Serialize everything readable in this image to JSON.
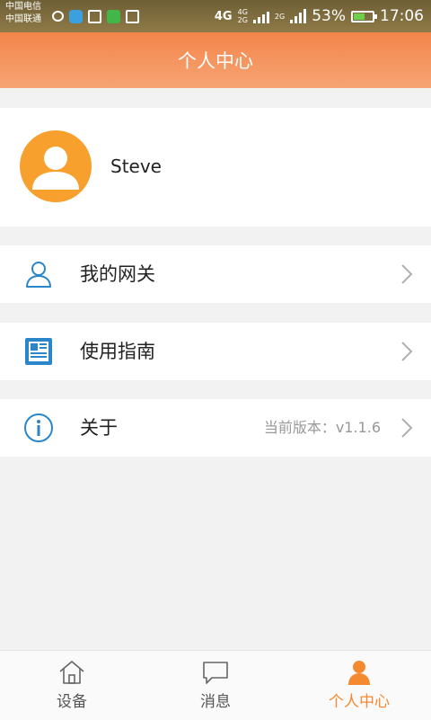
{
  "status_bar": {
    "carrier_1": "中国电信",
    "carrier_2": "中国联通",
    "network_4g": "4G",
    "network_4g_small": "4G",
    "network_2g_small": "2G",
    "network_2g": "2G",
    "battery_percent": "53%",
    "time": "17:06"
  },
  "header": {
    "title": "个人中心"
  },
  "profile": {
    "username": "Steve"
  },
  "menu": {
    "items": [
      {
        "label": "我的网关",
        "icon": "person-outline-icon"
      },
      {
        "label": "使用指南",
        "icon": "newspaper-icon"
      },
      {
        "label": "关于",
        "icon": "info-circle-icon",
        "version": "当前版本：v1.1.6"
      }
    ]
  },
  "bottom_nav": {
    "items": [
      {
        "label": "设备",
        "icon": "home-icon",
        "active": false
      },
      {
        "label": "消息",
        "icon": "chat-bubble-icon",
        "active": false
      },
      {
        "label": "个人中心",
        "icon": "person-filled-icon",
        "active": true
      }
    ]
  },
  "colors": {
    "accent": "#f5892f",
    "header_gradient_top": "#f4854a",
    "header_gradient_bottom": "#f6a474",
    "icon_blue": "#2a86c8",
    "avatar_orange": "#f7a02e",
    "background": "#f2f2f2"
  }
}
